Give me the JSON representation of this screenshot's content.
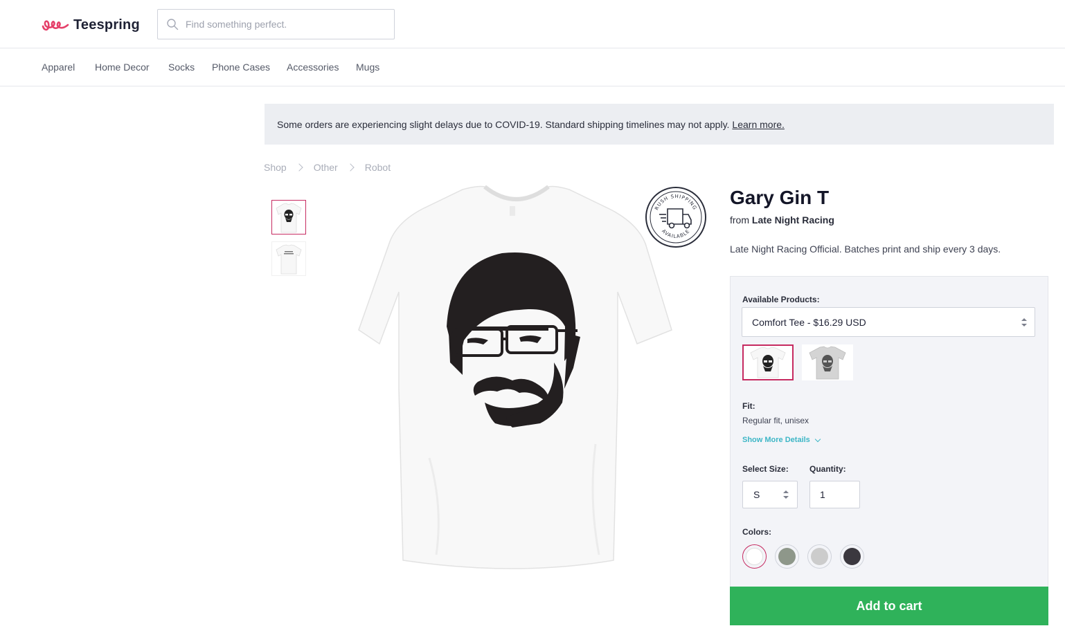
{
  "header": {
    "brand": "Teespring",
    "search_placeholder": "Find something perfect."
  },
  "categories": [
    "Apparel",
    "Home Decor",
    "Socks",
    "Phone Cases",
    "Accessories",
    "Mugs"
  ],
  "notice": {
    "text": "Some orders are experiencing slight delays due to COVID-19. Standard shipping timelines may not apply.",
    "link": "Learn more."
  },
  "breadcrumb": [
    "Shop",
    "Other",
    "Robot"
  ],
  "badge": {
    "line1": "RUSH SHIPPING",
    "line2": "AVAILABLE"
  },
  "product": {
    "title": "Gary Gin T",
    "from_label": "from",
    "seller": "Late Night Racing",
    "description": "Late Night Racing Official. Batches print and ship every 3 days."
  },
  "options": {
    "available_label": "Available Products:",
    "selected_product": "Comfort Tee - $16.29 USD",
    "fit_label": "Fit:",
    "fit_value": "Regular fit, unisex",
    "more_details": "Show More Details",
    "size_label": "Select Size:",
    "size_value": "S",
    "quantity_label": "Quantity:",
    "quantity_value": "1",
    "colors_label": "Colors:",
    "colors": [
      "#ffffff",
      "#8e978a",
      "#cccccc",
      "#3b383f"
    ],
    "selected_color_index": 0
  },
  "add_to_cart": "Add to cart",
  "colors": {
    "accent": "#c62a60",
    "cta": "#2fb25a",
    "link": "#3db6c6"
  }
}
